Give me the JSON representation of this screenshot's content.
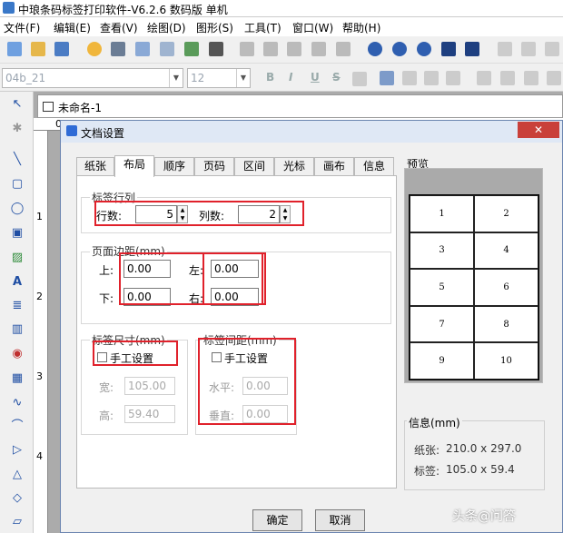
{
  "app": {
    "title": "中琅条码标签打印软件-V6.2.6 数码版 单机"
  },
  "menu": [
    {
      "label": "文件(F)"
    },
    {
      "label": "编辑(E)"
    },
    {
      "label": "查看(V)"
    },
    {
      "label": "绘图(D)"
    },
    {
      "label": "图形(S)"
    },
    {
      "label": "工具(T)"
    },
    {
      "label": "窗口(W)"
    },
    {
      "label": "帮助(H)"
    }
  ],
  "toolbar2": {
    "font_name": "04b_21",
    "font_size": "12",
    "bold": "B",
    "italic": "I",
    "underline": "U",
    "strike": "S"
  },
  "document": {
    "tab_name": "未命名-1"
  },
  "ruler": {
    "h": [
      "0"
    ],
    "v": [
      "1",
      "2",
      "3",
      "4"
    ]
  },
  "dialog": {
    "title": "文档设置",
    "close": "✕",
    "tabs": [
      {
        "label": "纸张"
      },
      {
        "label": "布局"
      },
      {
        "label": "顺序"
      },
      {
        "label": "页码"
      },
      {
        "label": "区间"
      },
      {
        "label": "光标"
      },
      {
        "label": "画布"
      },
      {
        "label": "信息"
      }
    ],
    "rows_cols": {
      "group": "标签行列",
      "rows_label": "行数:",
      "rows_value": "5",
      "cols_label": "列数:",
      "cols_value": "2"
    },
    "margins": {
      "group": "页面边距(mm)",
      "top_label": "上:",
      "top": "0.00",
      "left_label": "左:",
      "left": "0.00",
      "bottom_label": "下:",
      "bottom": "0.00",
      "right_label": "右:",
      "right": "0.00"
    },
    "label_size": {
      "group": "标签尺寸(mm)",
      "manual": "手工设置",
      "width_label": "宽:",
      "width": "105.00",
      "height_label": "高:",
      "height": "59.40"
    },
    "label_gap": {
      "group": "标签间距(mm)",
      "manual": "手工设置",
      "h_label": "水平:",
      "h": "0.00",
      "v_label": "垂直:",
      "v": "0.00"
    },
    "preview": {
      "title": "预览",
      "cells": [
        "1",
        "2",
        "3",
        "4",
        "5",
        "6",
        "7",
        "8",
        "9",
        "10"
      ]
    },
    "info": {
      "title": "信息(mm)",
      "paper_label": "纸张:",
      "paper": "210.0 x 297.0",
      "label_label": "标签:",
      "label": "105.0 x 59.4"
    },
    "ok": "确定",
    "cancel": "取消"
  },
  "watermark": "头条@问答"
}
